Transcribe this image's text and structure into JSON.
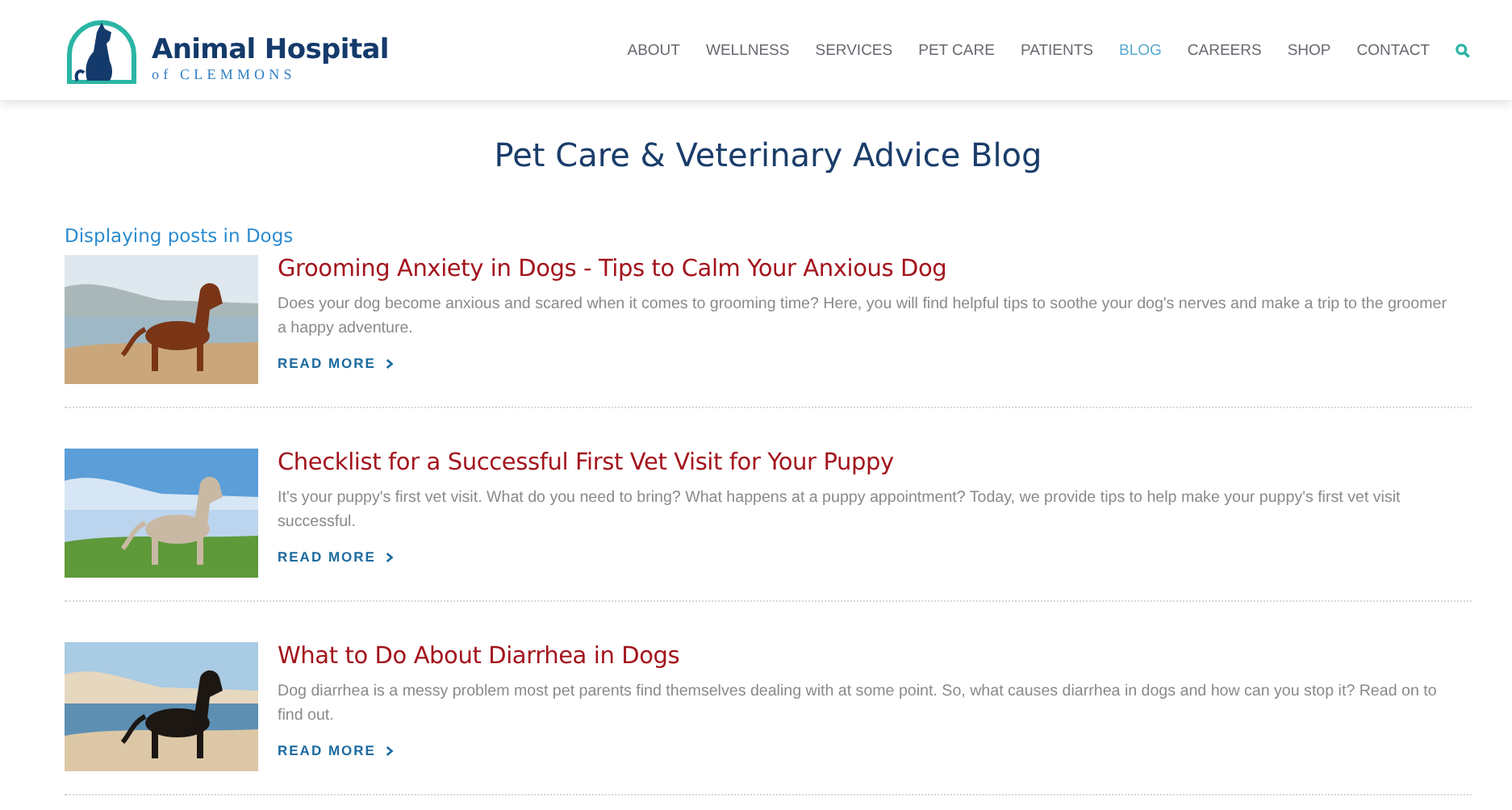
{
  "logo": {
    "name": "Animal Hospital",
    "subtitle": "of CLEMMONS"
  },
  "nav": [
    {
      "label": "ABOUT",
      "selected": false
    },
    {
      "label": "WELLNESS",
      "selected": false
    },
    {
      "label": "SERVICES",
      "selected": false
    },
    {
      "label": "PET CARE",
      "selected": false
    },
    {
      "label": "PATIENTS",
      "selected": false
    },
    {
      "label": "BLOG",
      "selected": true
    },
    {
      "label": "CAREERS",
      "selected": false
    },
    {
      "label": "SHOP",
      "selected": false
    },
    {
      "label": "CONTACT",
      "selected": false
    }
  ],
  "page_title": "Pet Care & Veterinary Advice Blog",
  "filter_label": "Displaying posts in Dogs",
  "posts": [
    {
      "title": "Grooming Anxiety in Dogs - Tips to Calm Your Anxious Dog",
      "excerpt": "Does your dog become anxious and scared when it comes to grooming time? Here, you will find helpful tips to soothe your dog's nerves and make a trip to the groomer a happy adventure.",
      "link": "READ MORE"
    },
    {
      "title": "Checklist for a Successful First Vet Visit for Your Puppy",
      "excerpt": "It's your puppy's first vet visit. What do you need to bring? What happens at a puppy appointment? Today, we provide tips to help make your puppy's first vet visit successful.",
      "link": "READ MORE"
    },
    {
      "title": "What to Do About Diarrhea in Dogs",
      "excerpt": "Dog diarrhea is a messy problem most pet parents find themselves dealing with at some point. So, what causes diarrhea in dogs and how can you stop it? Read on to find out.",
      "link": "READ MORE"
    }
  ]
}
